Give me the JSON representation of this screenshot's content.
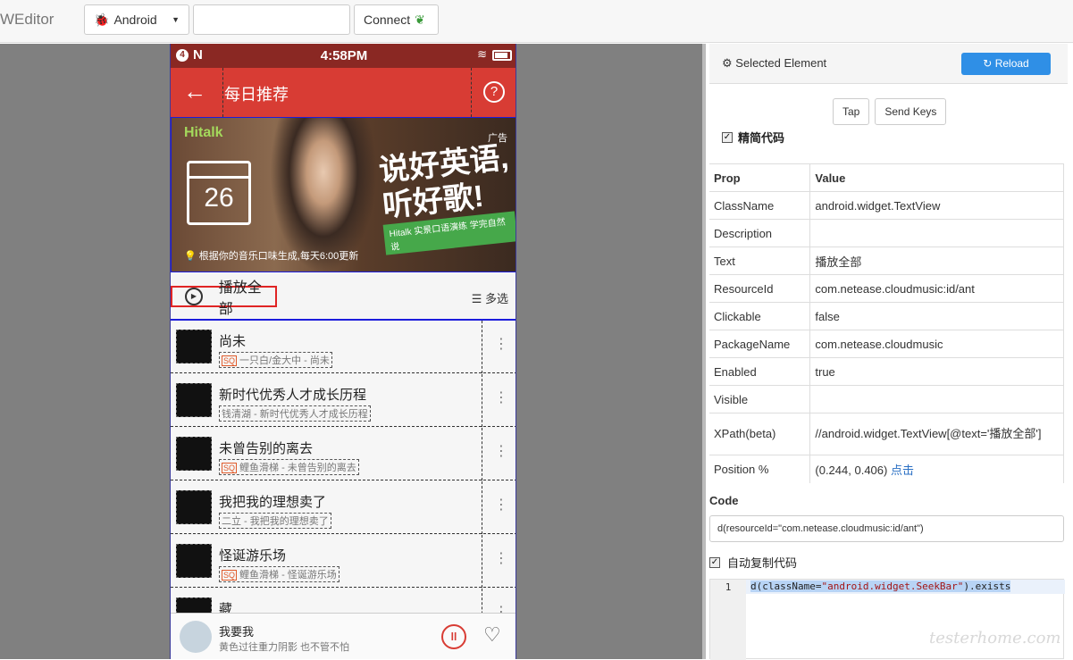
{
  "app": {
    "title": "WEditor"
  },
  "toolbar": {
    "platform": "Android",
    "serial_value": "",
    "connect_label": "Connect"
  },
  "phone": {
    "status": {
      "badge": "4",
      "nfc": "N",
      "time": "4:58PM"
    },
    "appbar": {
      "back_icon": "←",
      "title": "每日推荐",
      "help_icon": "?"
    },
    "banner": {
      "logo": "Hitalk",
      "ad_label": "广告",
      "calendar_day": "26",
      "slogan_line1": "说好英语,",
      "slogan_line2": "听好歌!",
      "tagline": "Hitalk 实景口语演练 学完自然说",
      "caption": "根据你的音乐口味生成,每天6:00更新"
    },
    "play_all": "播放全部",
    "multi_select": "多选",
    "songs": [
      {
        "name": "尚未",
        "meta": "一只白/金大中 - 尚未",
        "sq": true
      },
      {
        "name": "新时代优秀人才成长历程",
        "meta": "钱清湖 - 新时代优秀人才成长历程",
        "sq": false
      },
      {
        "name": "未曾告别的离去",
        "meta": "鲤鱼滑梯 - 未曾告别的离去",
        "sq": true
      },
      {
        "name": "我把我的理想卖了",
        "meta": "二立 - 我把我的理想卖了",
        "sq": false
      },
      {
        "name": "怪诞游乐场",
        "meta": "鲤鱼滑梯 - 怪诞游乐场",
        "sq": true
      },
      {
        "name": "藏",
        "meta": "",
        "sq": false
      }
    ],
    "player": {
      "title": "我要我",
      "subtitle": "黄色过往重力阴影 也不管不怕"
    }
  },
  "panel": {
    "title": "Selected Element",
    "reload_label": "Reload",
    "tap_label": "Tap",
    "send_keys_label": "Send Keys",
    "simplify_label": "精简代码",
    "table_head": {
      "prop": "Prop",
      "value": "Value"
    },
    "props": [
      {
        "k": "ClassName",
        "v": "android.widget.TextView"
      },
      {
        "k": "Description",
        "v": ""
      },
      {
        "k": "Text",
        "v": "播放全部"
      },
      {
        "k": "ResourceId",
        "v": "com.netease.cloudmusic:id/ant"
      },
      {
        "k": "Clickable",
        "v": "false"
      },
      {
        "k": "PackageName",
        "v": "com.netease.cloudmusic"
      },
      {
        "k": "Enabled",
        "v": "true"
      },
      {
        "k": "Visible",
        "v": ""
      },
      {
        "k": "XPath(beta)",
        "v": "//android.widget.TextView[@text='播放全部']"
      }
    ],
    "position": {
      "k": "Position %",
      "v": "(0.244, 0.406)",
      "link": "点击"
    },
    "code_label": "Code",
    "code_value": "d(resourceId=\"com.netease.cloudmusic:id/ant\")",
    "autocopy_label": "自动复制代码",
    "editor": {
      "line_no": "1",
      "pre": "d(className=",
      "str": "\"android.widget.SeekBar\"",
      "post": ").exists"
    }
  },
  "watermark": "testerhome.com"
}
